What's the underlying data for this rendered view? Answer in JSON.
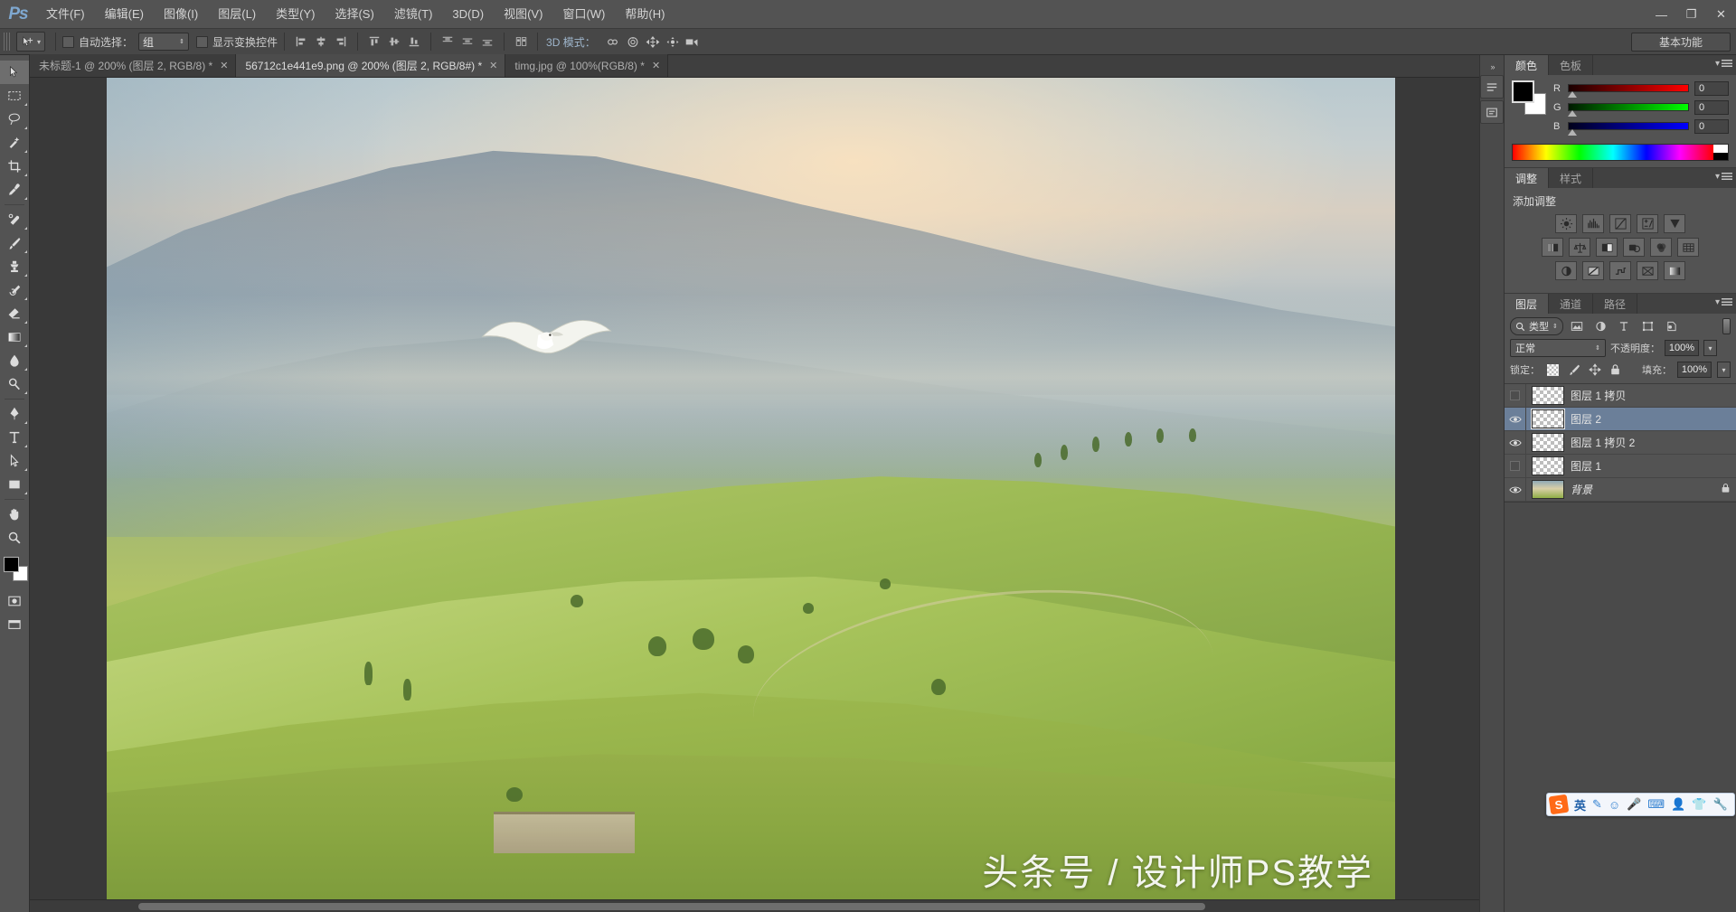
{
  "app": {
    "name": "Adobe Photoshop",
    "logo_text": "Ps"
  },
  "menubar": {
    "items": [
      {
        "label": "文件(F)",
        "name": "menu-file"
      },
      {
        "label": "编辑(E)",
        "name": "menu-edit"
      },
      {
        "label": "图像(I)",
        "name": "menu-image"
      },
      {
        "label": "图层(L)",
        "name": "menu-layer"
      },
      {
        "label": "类型(Y)",
        "name": "menu-type"
      },
      {
        "label": "选择(S)",
        "name": "menu-select"
      },
      {
        "label": "滤镜(T)",
        "name": "menu-filter"
      },
      {
        "label": "3D(D)",
        "name": "menu-3d"
      },
      {
        "label": "视图(V)",
        "name": "menu-view"
      },
      {
        "label": "窗口(W)",
        "name": "menu-window"
      },
      {
        "label": "帮助(H)",
        "name": "menu-help"
      }
    ],
    "window_controls": {
      "minimize": "—",
      "restore": "❐",
      "close": "✕"
    }
  },
  "options_bar": {
    "auto_select_label": "自动选择：",
    "auto_select_value": "组",
    "show_transform_label": "显示变换控件",
    "mode_3d_label": "3D 模式：",
    "workspace_label": "基本功能"
  },
  "tabs": [
    {
      "label": "未标题-1 @ 200% (图层 2, RGB/8) *",
      "close": "✕",
      "active": false
    },
    {
      "label": "56712c1e441e9.png @ 200% (图层 2, RGB/8#) *",
      "close": "✕",
      "active": true
    },
    {
      "label": "timg.jpg @ 100%(RGB/8) *",
      "close": "✕",
      "active": false
    }
  ],
  "canvas": {
    "watermark": "头条号 / 设计师PS教学",
    "zoom": "200%"
  },
  "color_panel": {
    "tabs": [
      {
        "label": "颜色",
        "active": true
      },
      {
        "label": "色板",
        "active": false
      }
    ],
    "channels": [
      {
        "label": "R",
        "value": "0"
      },
      {
        "label": "G",
        "value": "0"
      },
      {
        "label": "B",
        "value": "0"
      }
    ],
    "foreground_color": "#000000",
    "background_color": "#ffffff"
  },
  "adjust_panel": {
    "tabs": [
      {
        "label": "调整",
        "active": true
      },
      {
        "label": "样式",
        "active": false
      }
    ],
    "title": "添加调整",
    "rows": [
      [
        "brightness-contrast",
        "levels",
        "curves",
        "exposure",
        "vibrance"
      ],
      [
        "hue-saturation",
        "color-balance",
        "black-white",
        "photo-filter",
        "channel-mixer",
        "color-lookup"
      ],
      [
        "invert",
        "posterize",
        "threshold",
        "selective-color",
        "gradient-map"
      ]
    ]
  },
  "layers_panel": {
    "tabs": [
      {
        "label": "图层",
        "active": true
      },
      {
        "label": "通道",
        "active": false
      },
      {
        "label": "路径",
        "active": false
      }
    ],
    "filter_label": "类型",
    "blend_mode": "正常",
    "opacity_label": "不透明度：",
    "opacity_value": "100%",
    "lock_label": "锁定：",
    "fill_label": "填充：",
    "fill_value": "100%",
    "layers": [
      {
        "name": "图层 1 拷贝",
        "visible": false,
        "selected": false,
        "locked": false,
        "type": "transparent"
      },
      {
        "name": "图层 2",
        "visible": true,
        "selected": true,
        "locked": false,
        "type": "transparent"
      },
      {
        "name": "图层 1 拷贝 2",
        "visible": true,
        "selected": false,
        "locked": false,
        "type": "transparent"
      },
      {
        "name": "图层 1",
        "visible": false,
        "selected": false,
        "locked": false,
        "type": "transparent"
      },
      {
        "name": "背景",
        "visible": true,
        "selected": false,
        "locked": true,
        "type": "image"
      }
    ]
  },
  "toolbar": {
    "tools": [
      {
        "name": "move-tool",
        "glyph": "move",
        "active": true
      },
      {
        "name": "marquee-tool",
        "glyph": "marquee",
        "active": false
      },
      {
        "name": "lasso-tool",
        "glyph": "lasso",
        "active": false
      },
      {
        "name": "quick-selection-tool",
        "glyph": "wand",
        "active": false
      },
      {
        "name": "crop-tool",
        "glyph": "crop",
        "active": false
      },
      {
        "name": "eyedropper-tool",
        "glyph": "eyedropper",
        "active": false
      },
      {
        "name": "spot-healing-tool",
        "glyph": "heal",
        "active": false
      },
      {
        "name": "brush-tool",
        "glyph": "brush",
        "active": false
      },
      {
        "name": "clone-stamp-tool",
        "glyph": "stamp",
        "active": false
      },
      {
        "name": "history-brush-tool",
        "glyph": "history",
        "active": false
      },
      {
        "name": "eraser-tool",
        "glyph": "eraser",
        "active": false
      },
      {
        "name": "gradient-tool",
        "glyph": "gradient",
        "active": false
      },
      {
        "name": "blur-tool",
        "glyph": "blur",
        "active": false
      },
      {
        "name": "dodge-tool",
        "glyph": "dodge",
        "active": false
      },
      {
        "name": "pen-tool",
        "glyph": "pen",
        "active": false
      },
      {
        "name": "type-tool",
        "glyph": "type",
        "active": false
      },
      {
        "name": "path-selection-tool",
        "glyph": "path",
        "active": false
      },
      {
        "name": "rectangle-tool",
        "glyph": "rect",
        "active": false
      },
      {
        "name": "hand-tool",
        "glyph": "hand",
        "active": false
      },
      {
        "name": "zoom-tool",
        "glyph": "zoom",
        "active": false
      }
    ],
    "foreground_color": "#000000",
    "background_color": "#ffffff"
  },
  "ime": {
    "logo": "S",
    "mode": "英",
    "icons": [
      "pen-icon",
      "emoji-icon",
      "mic-icon",
      "keyboard-icon",
      "user-icon",
      "skin-icon",
      "tools-icon"
    ]
  }
}
